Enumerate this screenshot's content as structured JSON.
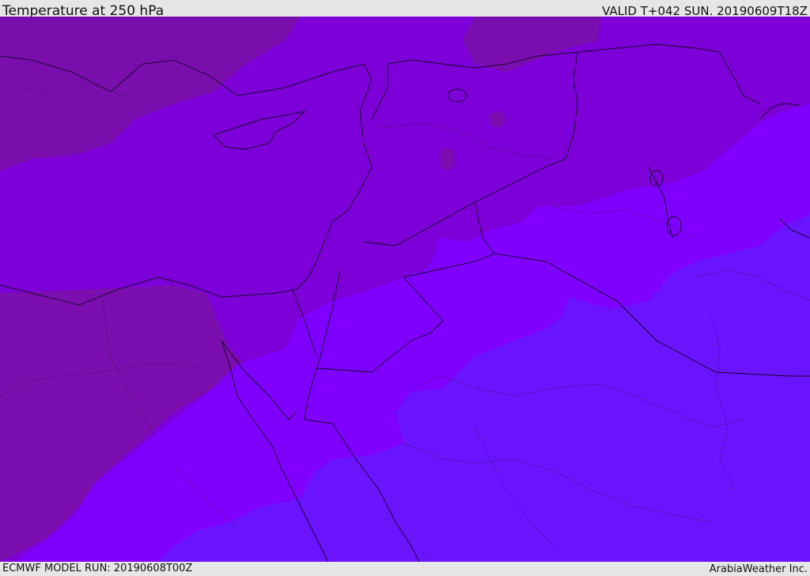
{
  "header": {
    "title": "Temperature at 250 hPa",
    "valid_time": "VALID T+042 SUN. 20190609T18Z"
  },
  "footer": {
    "model_run": "ECMWF MODEL RUN: 20190608T00Z",
    "credit": "ArabiaWeather Inc."
  },
  "map": {
    "field": "temperature",
    "level": "250 hPa",
    "colors": {
      "coldest_band": "#7a10a8",
      "cold_band": "#7d00d8",
      "mid_band": "#8000ff",
      "warm_band": "#6a14ff",
      "coastline": "#1a0a30",
      "border_dotted": "#30104a"
    }
  }
}
